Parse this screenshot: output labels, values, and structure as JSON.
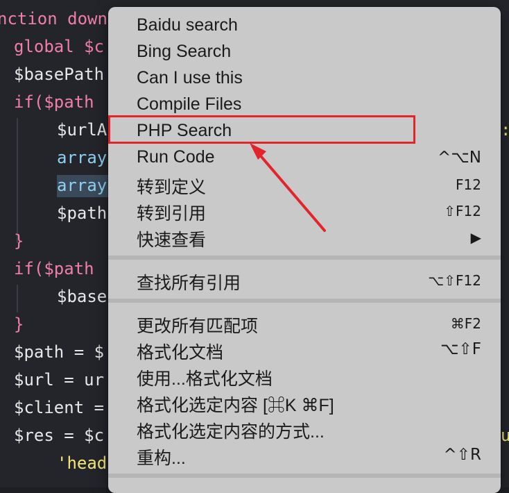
{
  "editor": {
    "lines": [
      {
        "text": "nction down",
        "color": "#f07fa8"
      },
      {
        "text": "global $c",
        "color": "#f07fa8"
      },
      {
        "text": "$basePath",
        "color": "#e8e8e8"
      },
      {
        "text": "if($path ",
        "color": "#f07fa8"
      },
      {
        "text": "$urlA",
        "color": "#e8e8e8"
      },
      {
        "text": "array",
        "color": "#8fd1f5"
      },
      {
        "text": "array",
        "color": "#8fd1f5"
      },
      {
        "text": "$path",
        "color": "#e8e8e8"
      },
      {
        "text": "}",
        "color": "#f07fa8"
      },
      {
        "text": "if($path ",
        "color": "#f07fa8"
      },
      {
        "text": "$base",
        "color": "#e8e8e8"
      },
      {
        "text": "}",
        "color": "#f07fa8"
      },
      {
        "text": "$path = $",
        "color": "#e8e8e8"
      },
      {
        "text": "$url = ur",
        "color": "#e8e8e8"
      },
      {
        "text": "$client =",
        "color": "#e8e8e8"
      },
      {
        "text": "$res = $c",
        "color": "#e8e8e8"
      },
      {
        "text": "'head",
        "color": "#f4e77a"
      }
    ],
    "right_fragments": [
      ":",
      "u"
    ]
  },
  "menu": {
    "items": [
      {
        "label": "Baidu search",
        "shortcut": ""
      },
      {
        "label": "Bing Search",
        "shortcut": ""
      },
      {
        "label": "Can I use this",
        "shortcut": ""
      },
      {
        "label": "Compile Files",
        "shortcut": ""
      },
      {
        "label": "PHP Search",
        "shortcut": ""
      },
      {
        "label": "Run Code",
        "shortcut": "^⌥N"
      },
      {
        "label": "转到定义",
        "shortcut": "F12"
      },
      {
        "label": "转到引用",
        "shortcut": "⇧F12"
      },
      {
        "label": "快速查看",
        "shortcut": "▶"
      }
    ],
    "group2": [
      {
        "label": "查找所有引用",
        "shortcut": "⌥⇧F12"
      }
    ],
    "group3": [
      {
        "label": "更改所有匹配项",
        "shortcut": "⌘F2"
      },
      {
        "label": "格式化文档",
        "shortcut": "⌥⇧F"
      },
      {
        "label": "使用...格式化文档",
        "shortcut": ""
      },
      {
        "label": "格式化选定内容 [⌘K ⌘F]",
        "shortcut": ""
      },
      {
        "label": "格式化选定内容的方式...",
        "shortcut": ""
      },
      {
        "label": "重构...",
        "shortcut": "^⇧R"
      }
    ]
  },
  "annotation": {
    "color": "#e3242b"
  }
}
